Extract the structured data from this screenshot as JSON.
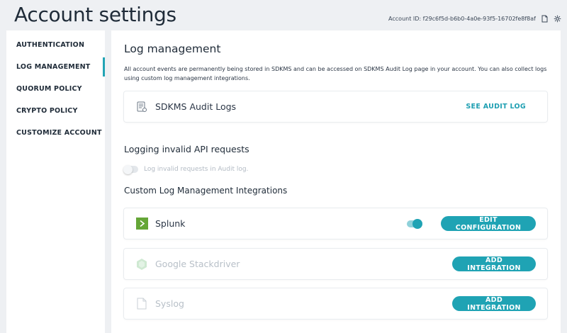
{
  "page": {
    "title": "Account settings",
    "account_id": "Account ID: f29c6f5d-b6b0-4a0e-93f5-16702fe8f8af"
  },
  "sidebar": {
    "items": [
      {
        "label": "AUTHENTICATION",
        "active": false
      },
      {
        "label": "LOG MANAGEMENT",
        "active": true
      },
      {
        "label": "QUORUM POLICY",
        "active": false
      },
      {
        "label": "CRYPTO POLICY",
        "active": false
      },
      {
        "label": "CUSTOMIZE ACCOUNT",
        "active": false
      }
    ]
  },
  "main": {
    "title": "Log management",
    "description": "All account events are permanently being stored in SDKMS and can be accessed on SDKMS Audit Log page in your account. You can also collect logs using custom log management integrations.",
    "audit_card": {
      "name": "SDKMS Audit Logs",
      "action": "SEE AUDIT LOG",
      "icon": "audit-log-icon"
    },
    "invalid_requests": {
      "title": "Logging invalid API requests",
      "toggle_label": "Log invalid requests in Audit log.",
      "enabled": false
    },
    "integrations": {
      "title": "Custom Log Management Integrations",
      "items": [
        {
          "name": "Splunk",
          "action": "EDIT CONFIGURATION",
          "enabled": true,
          "icon": "splunk-icon"
        },
        {
          "name": "Google Stackdriver",
          "action": "ADD INTEGRATION",
          "enabled": false,
          "icon": "stackdriver-icon"
        },
        {
          "name": "Syslog",
          "action": "ADD INTEGRATION",
          "enabled": false,
          "icon": "syslog-file-icon"
        }
      ]
    }
  },
  "colors": {
    "accent": "#1fa3b4",
    "background": "#eef0f3",
    "splunk_green": "#65a637"
  }
}
